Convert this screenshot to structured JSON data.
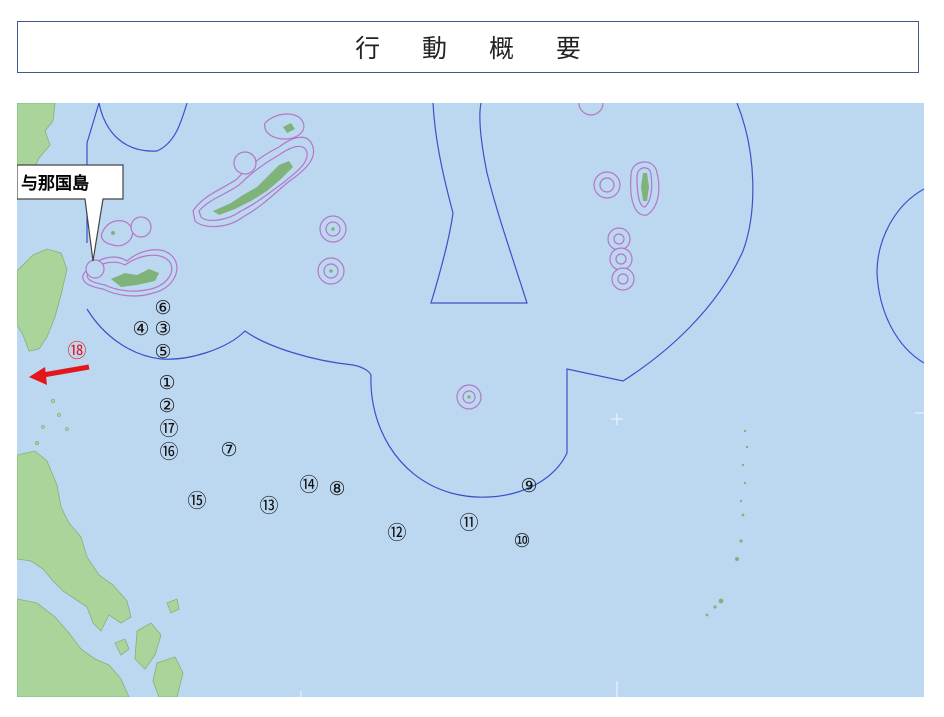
{
  "title": "行 動 概 要",
  "callout": {
    "label": "与那国島"
  },
  "colors": {
    "sea": "#bcd8f1",
    "land": "#a9d59a",
    "boundary": "#3a52c8",
    "territorial": "#b675c8",
    "heading_arrow": "#e4161c"
  },
  "markers": [
    {
      "id": 1,
      "label": "①"
    },
    {
      "id": 2,
      "label": "②"
    },
    {
      "id": 3,
      "label": "③"
    },
    {
      "id": 4,
      "label": "④"
    },
    {
      "id": 5,
      "label": "⑤"
    },
    {
      "id": 6,
      "label": "⑥"
    },
    {
      "id": 7,
      "label": "⑦"
    },
    {
      "id": 8,
      "label": "⑧"
    },
    {
      "id": 9,
      "label": "⑨"
    },
    {
      "id": 10,
      "label": "⑩"
    },
    {
      "id": 11,
      "label": "⑪"
    },
    {
      "id": 12,
      "label": "⑫"
    },
    {
      "id": 13,
      "label": "⑬"
    },
    {
      "id": 14,
      "label": "⑭"
    },
    {
      "id": 15,
      "label": "⑮"
    },
    {
      "id": 16,
      "label": "⑯"
    },
    {
      "id": 17,
      "label": "⑰"
    },
    {
      "id": 18,
      "label": "⑱",
      "color": "#e4161c"
    }
  ]
}
